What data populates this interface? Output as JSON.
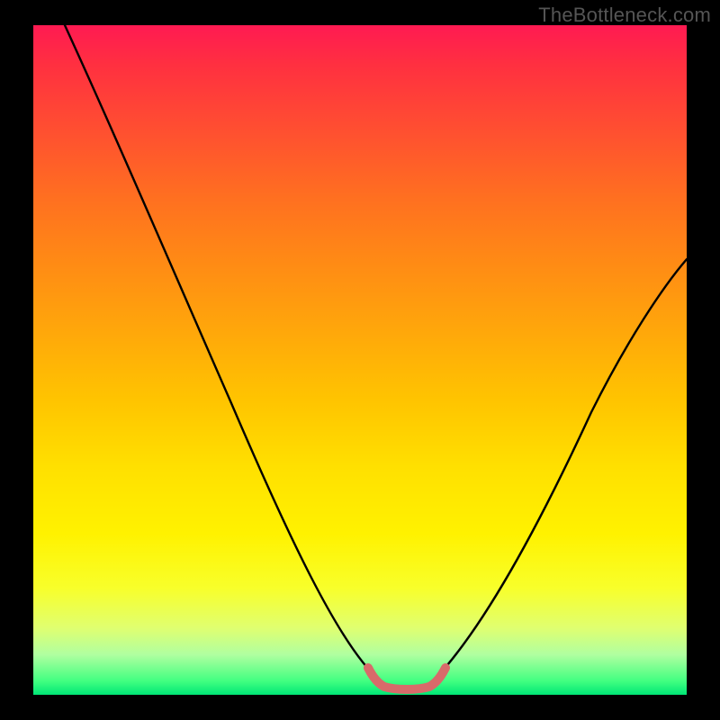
{
  "watermark": "TheBottleneck.com",
  "chart_data": {
    "type": "line",
    "title": "",
    "xlabel": "",
    "ylabel": "",
    "xlim": [
      0,
      100
    ],
    "ylim": [
      0,
      100
    ],
    "grid": false,
    "series": [
      {
        "name": "curve",
        "x": [
          10,
          15,
          20,
          25,
          30,
          35,
          40,
          45,
          50,
          53,
          55,
          57,
          59,
          61,
          65,
          70,
          75,
          80,
          85,
          90,
          95,
          100
        ],
        "y": [
          100,
          88,
          76,
          64,
          53,
          42,
          32,
          22,
          12,
          5,
          2,
          1,
          1,
          2,
          8,
          17,
          26,
          35,
          43,
          51,
          58,
          63
        ]
      },
      {
        "name": "plateau-highlight",
        "x": [
          53,
          55,
          57,
          59,
          61
        ],
        "y": [
          5,
          2,
          1,
          1,
          2
        ]
      }
    ],
    "colors": {
      "curve": "#000000",
      "plateau": "#d86a6a",
      "gradient_top": "#ff1a52",
      "gradient_bottom": "#00e676"
    }
  }
}
